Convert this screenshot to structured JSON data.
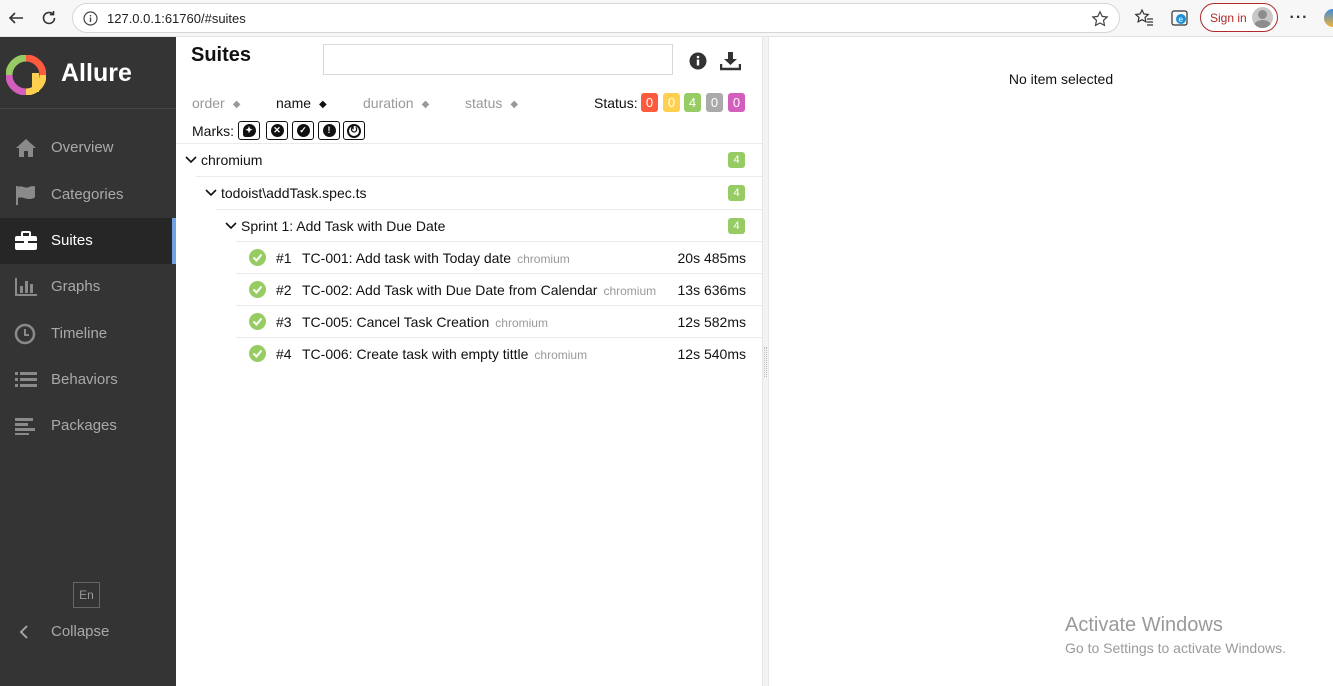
{
  "browser": {
    "url": "127.0.0.1:61760/#suites",
    "sign_in": "Sign in"
  },
  "sidebar": {
    "brand": "Allure",
    "items": [
      {
        "label": "Overview",
        "icon": "home-icon"
      },
      {
        "label": "Categories",
        "icon": "flag-icon"
      },
      {
        "label": "Suites",
        "icon": "briefcase-icon",
        "active": true
      },
      {
        "label": "Graphs",
        "icon": "bar-chart-icon"
      },
      {
        "label": "Timeline",
        "icon": "clock-icon"
      },
      {
        "label": "Behaviors",
        "icon": "list-icon"
      },
      {
        "label": "Packages",
        "icon": "align-left-icon"
      }
    ],
    "language": "En",
    "collapse": "Collapse"
  },
  "suites": {
    "title": "Suites",
    "search_value": "",
    "sort": {
      "order": "order",
      "name": "name",
      "duration": "duration",
      "status": "status"
    },
    "status_label": "Status:",
    "status_counts": {
      "failed": "0",
      "broken": "0",
      "passed": "4",
      "skipped": "0",
      "unknown": "0"
    },
    "status_colors": {
      "failed": "#fd5a3e",
      "broken": "#ffd050",
      "passed": "#97cc64",
      "skipped": "#aaaaaa",
      "unknown": "#d35ebe"
    },
    "marks_label": "Marks:",
    "tree": {
      "root": {
        "name": "chromium",
        "count": "4"
      },
      "file": {
        "name": "todoist\\addTask.spec.ts",
        "count": "4"
      },
      "suite": {
        "name": "Sprint 1: Add Task with Due Date",
        "count": "4"
      }
    },
    "tests": [
      {
        "num": "#1",
        "name": "TC-001: Add task with Today date",
        "tag": "chromium",
        "duration": "20s 485ms"
      },
      {
        "num": "#2",
        "name": "TC-002: Add Task with Due Date from Calendar",
        "tag": "chromium",
        "duration": "13s 636ms"
      },
      {
        "num": "#3",
        "name": "TC-005: Cancel Task Creation",
        "tag": "chromium",
        "duration": "12s 582ms"
      },
      {
        "num": "#4",
        "name": "TC-006: Create task with empty tittle",
        "tag": "chromium",
        "duration": "12s 540ms"
      }
    ]
  },
  "detail": {
    "empty_text": "No item selected"
  },
  "watermark": {
    "title": "Activate Windows",
    "subtitle": "Go to Settings to activate Windows."
  }
}
